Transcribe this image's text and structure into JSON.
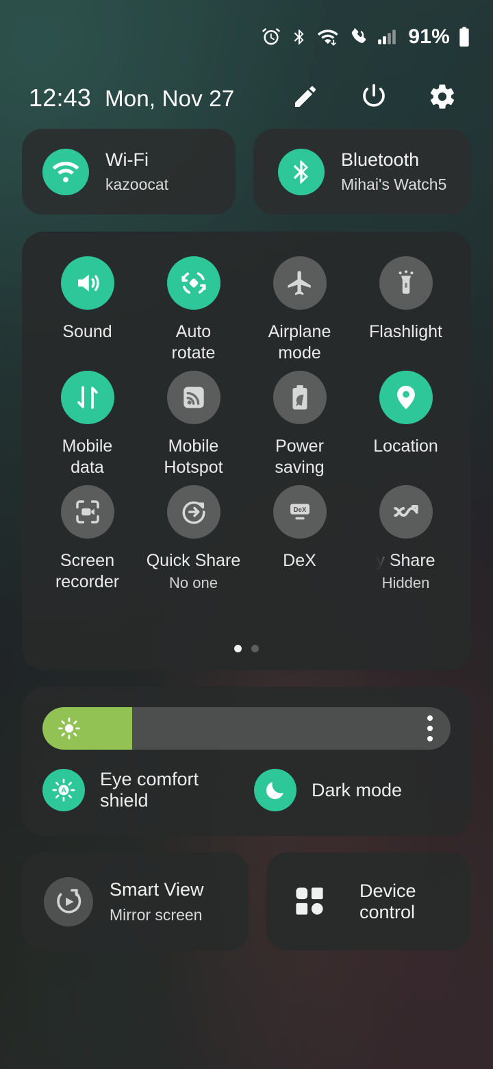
{
  "theme": {
    "accent_on": "#2dc79a",
    "accent_off": "#5b5d5d",
    "panel_bg": "#282a2a",
    "slider_fill": "#92c254",
    "text_primary": "#f2f2f2"
  },
  "status_bar": {
    "battery_percent": "91%",
    "icons": [
      "alarm-icon",
      "bluetooth-icon",
      "wifi-transfer-icon",
      "call-icon",
      "signal-bars-icon",
      "battery-icon"
    ]
  },
  "header": {
    "time": "12:43",
    "date": "Mon, Nov 27",
    "actions": [
      {
        "name": "edit-button",
        "icon": "pencil-icon"
      },
      {
        "name": "power-button",
        "icon": "power-icon"
      },
      {
        "name": "settings-button",
        "icon": "gear-icon"
      }
    ]
  },
  "connectivity_tiles": [
    {
      "title": "Wi-Fi",
      "subtitle": "kazoocat",
      "icon": "wifi-icon",
      "active": true
    },
    {
      "title": "Bluetooth",
      "subtitle": "Mihai's Watch5",
      "icon": "bluetooth-icon",
      "active": true
    }
  ],
  "quick_settings": {
    "tiles": [
      {
        "label": "Sound",
        "subtitle": "",
        "icon": "speaker-icon",
        "active": true
      },
      {
        "label": "Auto\nrotate",
        "subtitle": "",
        "icon": "auto-rotate-icon",
        "active": true
      },
      {
        "label": "Airplane\nmode",
        "subtitle": "",
        "icon": "airplane-icon",
        "active": false
      },
      {
        "label": "Flashlight",
        "subtitle": "",
        "icon": "flashlight-icon",
        "active": false
      },
      {
        "label": "Mobile\ndata",
        "subtitle": "",
        "icon": "mobile-data-icon",
        "active": true
      },
      {
        "label": "Mobile\nHotspot",
        "subtitle": "",
        "icon": "hotspot-icon",
        "active": false
      },
      {
        "label": "Power\nsaving",
        "subtitle": "",
        "icon": "power-saving-icon",
        "active": false
      },
      {
        "label": "Location",
        "subtitle": "",
        "icon": "location-pin-icon",
        "active": true
      },
      {
        "label": "Screen\nrecorder",
        "subtitle": "",
        "icon": "screen-recorder-icon",
        "active": false
      },
      {
        "label": "Quick Share",
        "subtitle": "No one",
        "icon": "quick-share-icon",
        "active": false
      },
      {
        "label": "DeX",
        "subtitle": "",
        "icon": "dex-icon",
        "active": false
      },
      {
        "label": "y Share",
        "subtitle": "Hidden",
        "icon": "music-share-icon",
        "active": false
      }
    ],
    "page_count": 2,
    "active_page": 1
  },
  "brightness": {
    "level_percent": 22,
    "sun_icon": "brightness-sun-icon",
    "more_icon": "more-options-icon"
  },
  "display_modes": [
    {
      "label": "Eye comfort shield",
      "icon": "eye-comfort-icon",
      "active": true
    },
    {
      "label": "Dark mode",
      "icon": "moon-icon",
      "active": true
    }
  ],
  "bottom_tiles": [
    {
      "title": "Smart View",
      "subtitle": "Mirror screen",
      "icon": "smart-view-icon"
    },
    {
      "title": "Device control",
      "subtitle": "",
      "icon": "device-control-icon"
    }
  ]
}
